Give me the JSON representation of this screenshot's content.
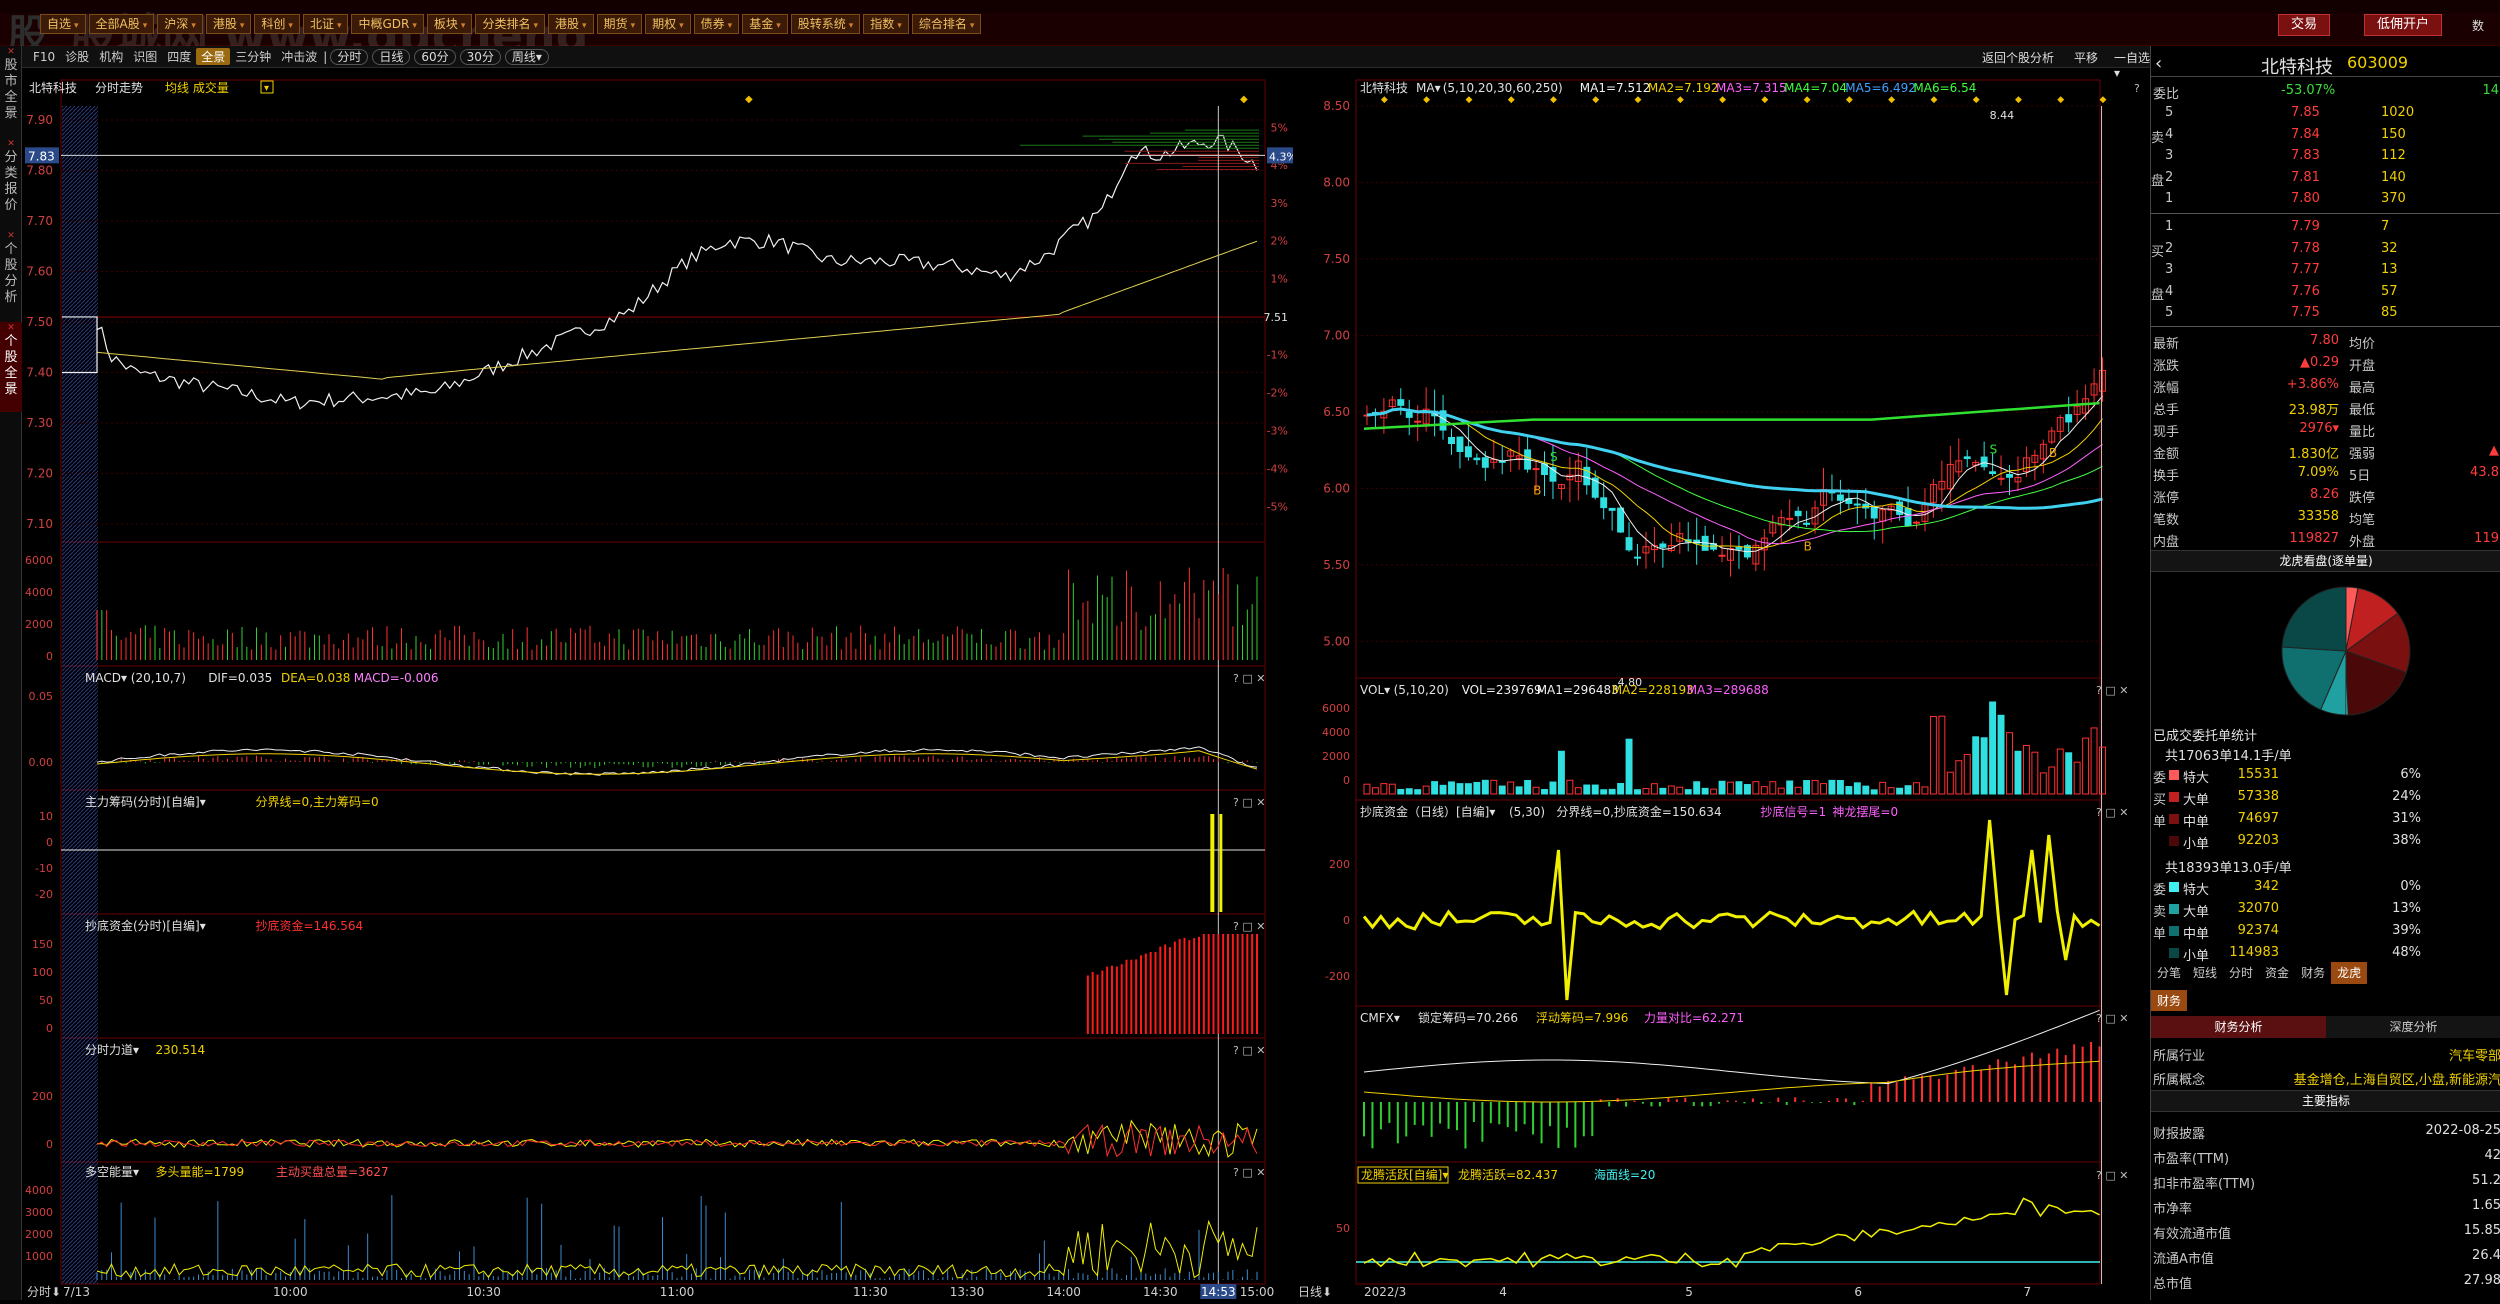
{
  "topbar": {
    "logo": "股",
    "watermark": "股城网 www.gucheng",
    "menus": [
      {
        "label": "自选"
      },
      {
        "label": "全部A股"
      },
      {
        "label": "沪深"
      },
      {
        "label": "港股"
      },
      {
        "label": "科创"
      },
      {
        "label": "北证"
      },
      {
        "label": "中概GDR"
      },
      {
        "label": "板块"
      },
      {
        "label": "分类排名"
      },
      {
        "label": "港股"
      },
      {
        "label": "期货"
      },
      {
        "label": "期权"
      },
      {
        "label": "债券"
      },
      {
        "label": "基金"
      },
      {
        "label": "股转系统"
      },
      {
        "label": "指数"
      },
      {
        "label": "综合排名"
      }
    ],
    "trade_button": "交易",
    "open_account_button": "低佣开户",
    "right_partial": "数"
  },
  "leftdock": {
    "tabs": [
      {
        "label": "股市全景",
        "active": false
      },
      {
        "label": "分类报价",
        "active": false
      },
      {
        "label": "个股分析",
        "active": false
      },
      {
        "label": "个股全景",
        "active": true
      }
    ]
  },
  "toolbar": {
    "items": [
      {
        "label": "F10",
        "sel": false
      },
      {
        "label": "诊股",
        "sel": false
      },
      {
        "label": "机构",
        "sel": false
      },
      {
        "label": "识图",
        "sel": false
      },
      {
        "label": "四度",
        "sel": false
      },
      {
        "label": "全景",
        "sel": true
      },
      {
        "label": "三分钟",
        "sel": false
      },
      {
        "label": "冲击波",
        "sel": false
      }
    ],
    "pills": [
      {
        "label": "分时"
      },
      {
        "label": "日线"
      },
      {
        "label": "60分"
      },
      {
        "label": "30分"
      },
      {
        "label": "周线▾"
      }
    ],
    "right_items": [
      "返回个股分析",
      "平移",
      "一自选▾",
      "?",
      "□",
      "✕"
    ]
  },
  "intraday": {
    "stock_name": "北特科技",
    "chart_label": "分时走势",
    "overlay_label": "均线 成交量",
    "price_ticks": [
      "7.90",
      "7.80",
      "7.70",
      "7.60",
      "7.50",
      "7.40",
      "7.30",
      "7.20",
      "7.10"
    ],
    "price_tick_values": [
      7.9,
      7.8,
      7.7,
      7.6,
      7.5,
      7.4,
      7.3,
      7.2,
      7.1
    ],
    "pct_ticks": [
      "5%",
      "4%",
      "3%",
      "2%",
      "1%",
      "7.51",
      "-1%",
      "-2%",
      "-3%",
      "-4%",
      "-5%"
    ],
    "current_price_tag": "7.83",
    "current_pct_tag": "4.3%",
    "vol_ticks": [
      "6000",
      "4000",
      "2000",
      "0"
    ],
    "time_labels": [
      "7/13",
      "10:00",
      "10:30",
      "11:00",
      "11:30",
      "13:30",
      "14:00",
      "14:30",
      "14:53",
      "15:00"
    ],
    "mode_label": "分时",
    "macd_label": "MACD▾  (20,10,7)",
    "macd_dif": "DIF=0.035",
    "macd_dea": "DEA=0.038",
    "macd_val": "MACD=-0.006",
    "macd_ticks": [
      "0.05",
      "0.00"
    ],
    "zlcm_label": "主力筹码(分时)[自编]▾",
    "zlcm_values": "分界线=0,主力筹码=0",
    "zlcm_ticks": [
      "10",
      "0",
      "-10",
      "-20"
    ],
    "cdzj_label": "抄底资金(分时)[自编]▾",
    "cdzj_values": "抄底资金=146.564",
    "cdzj_ticks": [
      "150",
      "100",
      "50",
      "0"
    ],
    "fsld_label": "分时力道▾",
    "fsld_value": "230.514",
    "fsld_ticks": [
      "200",
      "0"
    ],
    "dkn_label": "多空能量▾",
    "dkn_v1": "多头量能=1799",
    "dkn_v2": "主动买盘总量=3627",
    "dkn_ticks": [
      "4000",
      "3000",
      "2000",
      "1000"
    ]
  },
  "daily": {
    "stock_name": "北特科技",
    "ma_label": "MA▾",
    "ma_params": "(5,10,20,30,60,250)",
    "ma1": "MA1=7.512",
    "ma2": "MA2=7.192",
    "ma3": "MA3=7.315",
    "ma4": "MA4=7.04",
    "ma5": "MA5=6.492",
    "ma6": "MA6=6.54",
    "price_ticks": [
      "8.50",
      "8.00",
      "7.50",
      "7.00",
      "6.50",
      "6.00",
      "5.50",
      "5.00"
    ],
    "price_tick_values": [
      8.5,
      8.0,
      7.5,
      7.0,
      6.5,
      6.0,
      5.5,
      5.0
    ],
    "high_label": "8.44",
    "low_label": "4.80",
    "vol_label": "VOL▾",
    "vol_params": "(5,10,20)",
    "vol_val": "VOL=239769",
    "vol_ma1": "MA1=296483",
    "vol_ma2": "MA2=228193",
    "vol_ma3": "MA3=289688",
    "vol_ticks": [
      "6000",
      "4000",
      "2000",
      "0"
    ],
    "cd_label": "抄底资金（日线）[自编]▾",
    "cd_params": "(5,30)",
    "cd_values": "分界线=0,抄底资金=150.634",
    "cd_sig": "抄底信号=1",
    "cd_sig2": "神龙摆尾=0",
    "cd_ticks": [
      "200",
      "0",
      "-200"
    ],
    "cmfx_label": "CMFX▾",
    "cmfx_v1": "锁定筹码=70.266",
    "cmfx_v2": "浮动筹码=7.996",
    "cmfx_v3": "力量对比=62.271",
    "lt_label": "龙腾活跃[自编]▾",
    "lt_v1": "龙腾活跃=82.437",
    "lt_v2": "海面线=20",
    "lt_ticks": [
      "50"
    ],
    "date_labels": [
      "2022/3",
      "4",
      "5",
      "6",
      "7"
    ],
    "mode_label": "日线"
  },
  "quote": {
    "back_icon": "‹",
    "name": "北特科技",
    "code": "603009",
    "weibi_label": "委比",
    "weibi": "-53.07%",
    "weicha": "14",
    "sell_label": "卖",
    "buy_label": "买",
    "pan_label": "盘",
    "asks": [
      {
        "lvl": "5",
        "price": "7.85",
        "vol": "1020"
      },
      {
        "lvl": "4",
        "price": "7.84",
        "vol": "150"
      },
      {
        "lvl": "3",
        "price": "7.83",
        "vol": "112"
      },
      {
        "lvl": "2",
        "price": "7.81",
        "vol": "140"
      },
      {
        "lvl": "1",
        "price": "7.80",
        "vol": "370"
      }
    ],
    "bids": [
      {
        "lvl": "1",
        "price": "7.79",
        "vol": "7"
      },
      {
        "lvl": "2",
        "price": "7.78",
        "vol": "32"
      },
      {
        "lvl": "3",
        "price": "7.77",
        "vol": "13"
      },
      {
        "lvl": "4",
        "price": "7.76",
        "vol": "57"
      },
      {
        "lvl": "5",
        "price": "7.75",
        "vol": "85"
      }
    ],
    "stats": [
      {
        "k": "最新",
        "v": "7.80",
        "k2": "均价",
        "v2": ""
      },
      {
        "k": "涨跌",
        "v": "▲0.29",
        "k2": "开盘",
        "v2": ""
      },
      {
        "k": "涨幅",
        "v": "+3.86%",
        "k2": "最高",
        "v2": ""
      },
      {
        "k": "总手",
        "v": "23.98万",
        "k2": "最低",
        "v2": ""
      },
      {
        "k": "现手",
        "v": "2976▾",
        "k2": "量比",
        "v2": ""
      },
      {
        "k": "金额",
        "v": "1.830亿",
        "k2": "强弱",
        "v2": "▲"
      },
      {
        "k": "换手",
        "v": "7.09%",
        "k2": "5日",
        "v2": "43.8"
      },
      {
        "k": "涨停",
        "v": "8.26",
        "k2": "跌停",
        "v2": ""
      },
      {
        "k": "笔数",
        "v": "33358",
        "k2": "均笔",
        "v2": ""
      },
      {
        "k": "内盘",
        "v": "119827",
        "k2": "外盘",
        "v2": "119"
      }
    ],
    "lhkp_title": "龙虎看盘(逐单量)",
    "pie_slices": [
      {
        "value": 6,
        "color": "#ff5a5a"
      },
      {
        "value": 24,
        "color": "#c02020"
      },
      {
        "value": 31,
        "color": "#7a1010"
      },
      {
        "value": 38,
        "color": "#4a0808"
      },
      {
        "value": 1,
        "color": "#40f0f0"
      },
      {
        "value": 13,
        "color": "#20a0a0"
      },
      {
        "value": 39,
        "color": "#107070"
      },
      {
        "value": 48,
        "color": "#0a4848"
      }
    ],
    "deal_title": "已成交委托单统计",
    "buy_total": "共17063单14.1手/单",
    "buy_rows": [
      {
        "name": "特大",
        "vol": "15531",
        "pct": "6%",
        "color": "#ff5a5a"
      },
      {
        "name": "大单",
        "vol": "57338",
        "pct": "24%",
        "color": "#c02020"
      },
      {
        "name": "中单",
        "vol": "74697",
        "pct": "31%",
        "color": "#7a1010"
      },
      {
        "name": "小单",
        "vol": "92203",
        "pct": "38%",
        "color": "#4a0808"
      }
    ],
    "buy_side": [
      "委",
      "买",
      "单"
    ],
    "sell_total": "共18393单13.0手/单",
    "sell_rows": [
      {
        "name": "特大",
        "vol": "342",
        "pct": "0%",
        "color": "#40f0f0"
      },
      {
        "name": "大单",
        "vol": "32070",
        "pct": "13%",
        "color": "#20a0a0"
      },
      {
        "name": "中单",
        "vol": "92374",
        "pct": "39%",
        "color": "#107070"
      },
      {
        "name": "小单",
        "vol": "114983",
        "pct": "48%",
        "color": "#0a4848"
      }
    ],
    "sell_side": [
      "委",
      "卖",
      "单"
    ],
    "tabs": [
      {
        "label": "分笔",
        "on": false
      },
      {
        "label": "短线",
        "on": false
      },
      {
        "label": "分时",
        "on": false
      },
      {
        "label": "资金",
        "on": false
      },
      {
        "label": "财务",
        "on": false
      },
      {
        "label": "龙虎",
        "on": true
      }
    ],
    "fin_tab": "财务",
    "fin_tabs": [
      "财务分析",
      "深度分析"
    ],
    "industry_label": "所属行业",
    "industry": "汽车零部",
    "concept_label": "所属概念",
    "concept": "基金增仓,上海自贸区,小盘,新能源汽",
    "main_index": "主要指标",
    "indicators": [
      {
        "k": "财报披露",
        "v": "2022-08-25"
      },
      {
        "k": "市盈率(TTM)",
        "v": "42"
      },
      {
        "k": "扣非市盈率(TTM)",
        "v": "51.2"
      },
      {
        "k": "市净率",
        "v": "1.65"
      },
      {
        "k": "有效流通市值",
        "v": "15.85"
      },
      {
        "k": "流通A市值",
        "v": "26.4"
      },
      {
        "k": "总市值",
        "v": "27.98"
      }
    ]
  }
}
